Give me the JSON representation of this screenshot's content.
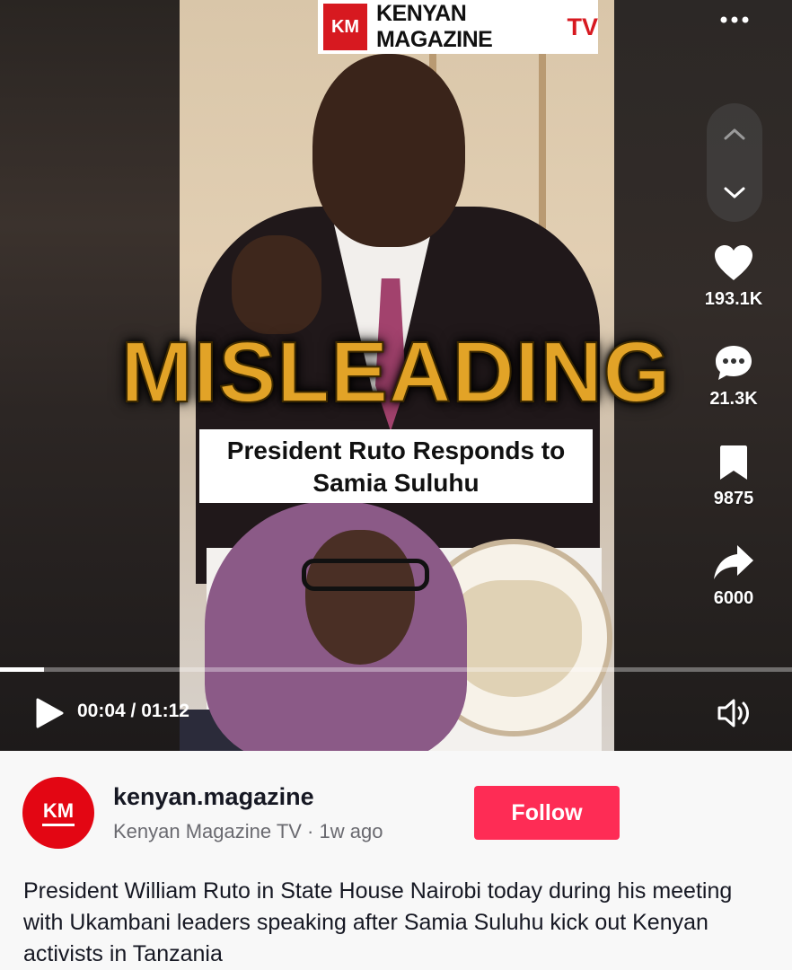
{
  "brand": {
    "logo_text": "KM",
    "name": "KENYAN MAGAZINE",
    "suffix": "TV"
  },
  "video": {
    "overlay_label": "MISLEADING",
    "caption": "President Ruto Responds to Samia Suluhu",
    "progress_fraction": 0.055,
    "current_time": "00:04",
    "duration": "01:12",
    "time_display": "00:04 / 01:12"
  },
  "actions": {
    "likes": "193.1K",
    "comments": "21.3K",
    "saves": "9875",
    "shares": "6000"
  },
  "author": {
    "avatar_text": "KM",
    "username": "kenyan.magazine",
    "meta": "Kenyan Magazine TV · 1w ago"
  },
  "follow_label": "Follow",
  "description": "President William Ruto in State House Nairobi today during his meeting with Ukambani leaders speaking after Samia Suluhu kick out Kenyan activists in Tanzania",
  "colors": {
    "accent": "#fe2c55",
    "overlay_gold": "#e2a327",
    "brand_red": "#d71920"
  },
  "icons": [
    "more-icon",
    "chevron-up-icon",
    "chevron-down-icon",
    "heart-icon",
    "comment-icon",
    "bookmark-icon",
    "share-icon",
    "play-icon",
    "volume-icon"
  ]
}
